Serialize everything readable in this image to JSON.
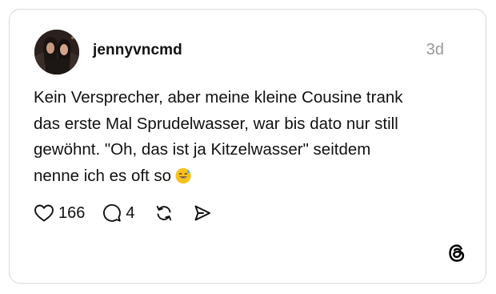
{
  "post": {
    "username": "jennyvncmd",
    "timestamp": "3d",
    "text_lines": [
      "Kein Versprecher, aber meine kleine Cousine trank",
      "das erste Mal Sprudelwasser, war bis dato nur still",
      "gewöhnt. \"Oh, das ist ja Kitzelwasser\" seitdem",
      "nenne ich es oft so"
    ],
    "emoji": "grinning-face-with-sweat",
    "likes": "166",
    "replies": "4"
  },
  "icons": {
    "like": "heart-icon",
    "reply": "speech-bubble-icon",
    "repost": "repost-arrows-icon",
    "share": "send-icon",
    "brand": "threads-logo-icon"
  },
  "colors": {
    "text": "#111111",
    "muted": "#999999",
    "border": "#d9d9d9"
  }
}
